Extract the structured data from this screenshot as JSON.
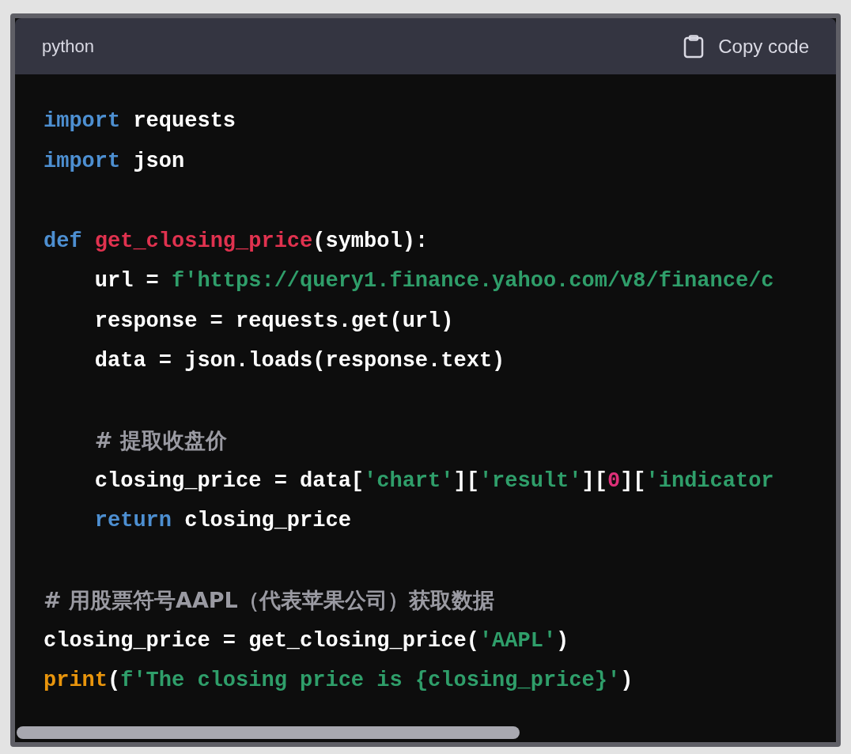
{
  "code_block": {
    "language": "python",
    "copy_button": "Copy code",
    "lines": [
      {
        "kind": "code",
        "indented": false,
        "tokens": [
          {
            "kind": "keyword",
            "text": "import"
          },
          {
            "kind": "plain",
            "text": " requests"
          }
        ]
      },
      {
        "kind": "code",
        "indented": false,
        "tokens": [
          {
            "kind": "keyword",
            "text": "import"
          },
          {
            "kind": "plain",
            "text": " json"
          }
        ]
      },
      {
        "kind": "blank"
      },
      {
        "kind": "code",
        "indented": false,
        "tokens": [
          {
            "kind": "keyword",
            "text": "def"
          },
          {
            "kind": "function",
            "text": " get_closing_price"
          },
          {
            "kind": "plain",
            "text": "(symbol):"
          }
        ]
      },
      {
        "kind": "code",
        "indented": true,
        "tokens": [
          {
            "kind": "plain",
            "text": "url = "
          },
          {
            "kind": "string",
            "text": "f'https://query1.finance.yahoo.com/v8/finance/c"
          }
        ]
      },
      {
        "kind": "code",
        "indented": true,
        "tokens": [
          {
            "kind": "plain",
            "text": "response = requests.get(url)"
          }
        ]
      },
      {
        "kind": "code",
        "indented": true,
        "tokens": [
          {
            "kind": "plain",
            "text": "data = json.loads(response.text)"
          }
        ]
      },
      {
        "kind": "blank"
      },
      {
        "kind": "code",
        "indented": true,
        "tokens": [
          {
            "kind": "comment",
            "text": "# 提取收盘价"
          }
        ]
      },
      {
        "kind": "code",
        "indented": true,
        "tokens": [
          {
            "kind": "plain",
            "text": "closing_price = data["
          },
          {
            "kind": "string",
            "text": "'chart'"
          },
          {
            "kind": "plain",
            "text": "]["
          },
          {
            "kind": "string",
            "text": "'result'"
          },
          {
            "kind": "plain",
            "text": "]["
          },
          {
            "kind": "number",
            "text": "0"
          },
          {
            "kind": "plain",
            "text": "]["
          },
          {
            "kind": "string",
            "text": "'indicator"
          }
        ]
      },
      {
        "kind": "code",
        "indented": true,
        "tokens": [
          {
            "kind": "keyword",
            "text": "return"
          },
          {
            "kind": "plain",
            "text": " closing_price"
          }
        ]
      },
      {
        "kind": "blank"
      },
      {
        "kind": "code",
        "indented": false,
        "tokens": [
          {
            "kind": "comment",
            "text": "# 用股票符号AAPL（代表苹果公司）获取数据"
          }
        ]
      },
      {
        "kind": "code",
        "indented": false,
        "tokens": [
          {
            "kind": "plain",
            "text": "closing_price = get_closing_price("
          },
          {
            "kind": "string",
            "text": "'AAPL'"
          },
          {
            "kind": "plain",
            "text": ")"
          }
        ]
      },
      {
        "kind": "code",
        "indented": false,
        "tokens": [
          {
            "kind": "builtin",
            "text": "print"
          },
          {
            "kind": "plain",
            "text": "("
          },
          {
            "kind": "string",
            "text": "f'The closing price is {closing_price}'"
          },
          {
            "kind": "plain",
            "text": ")"
          }
        ]
      }
    ]
  }
}
